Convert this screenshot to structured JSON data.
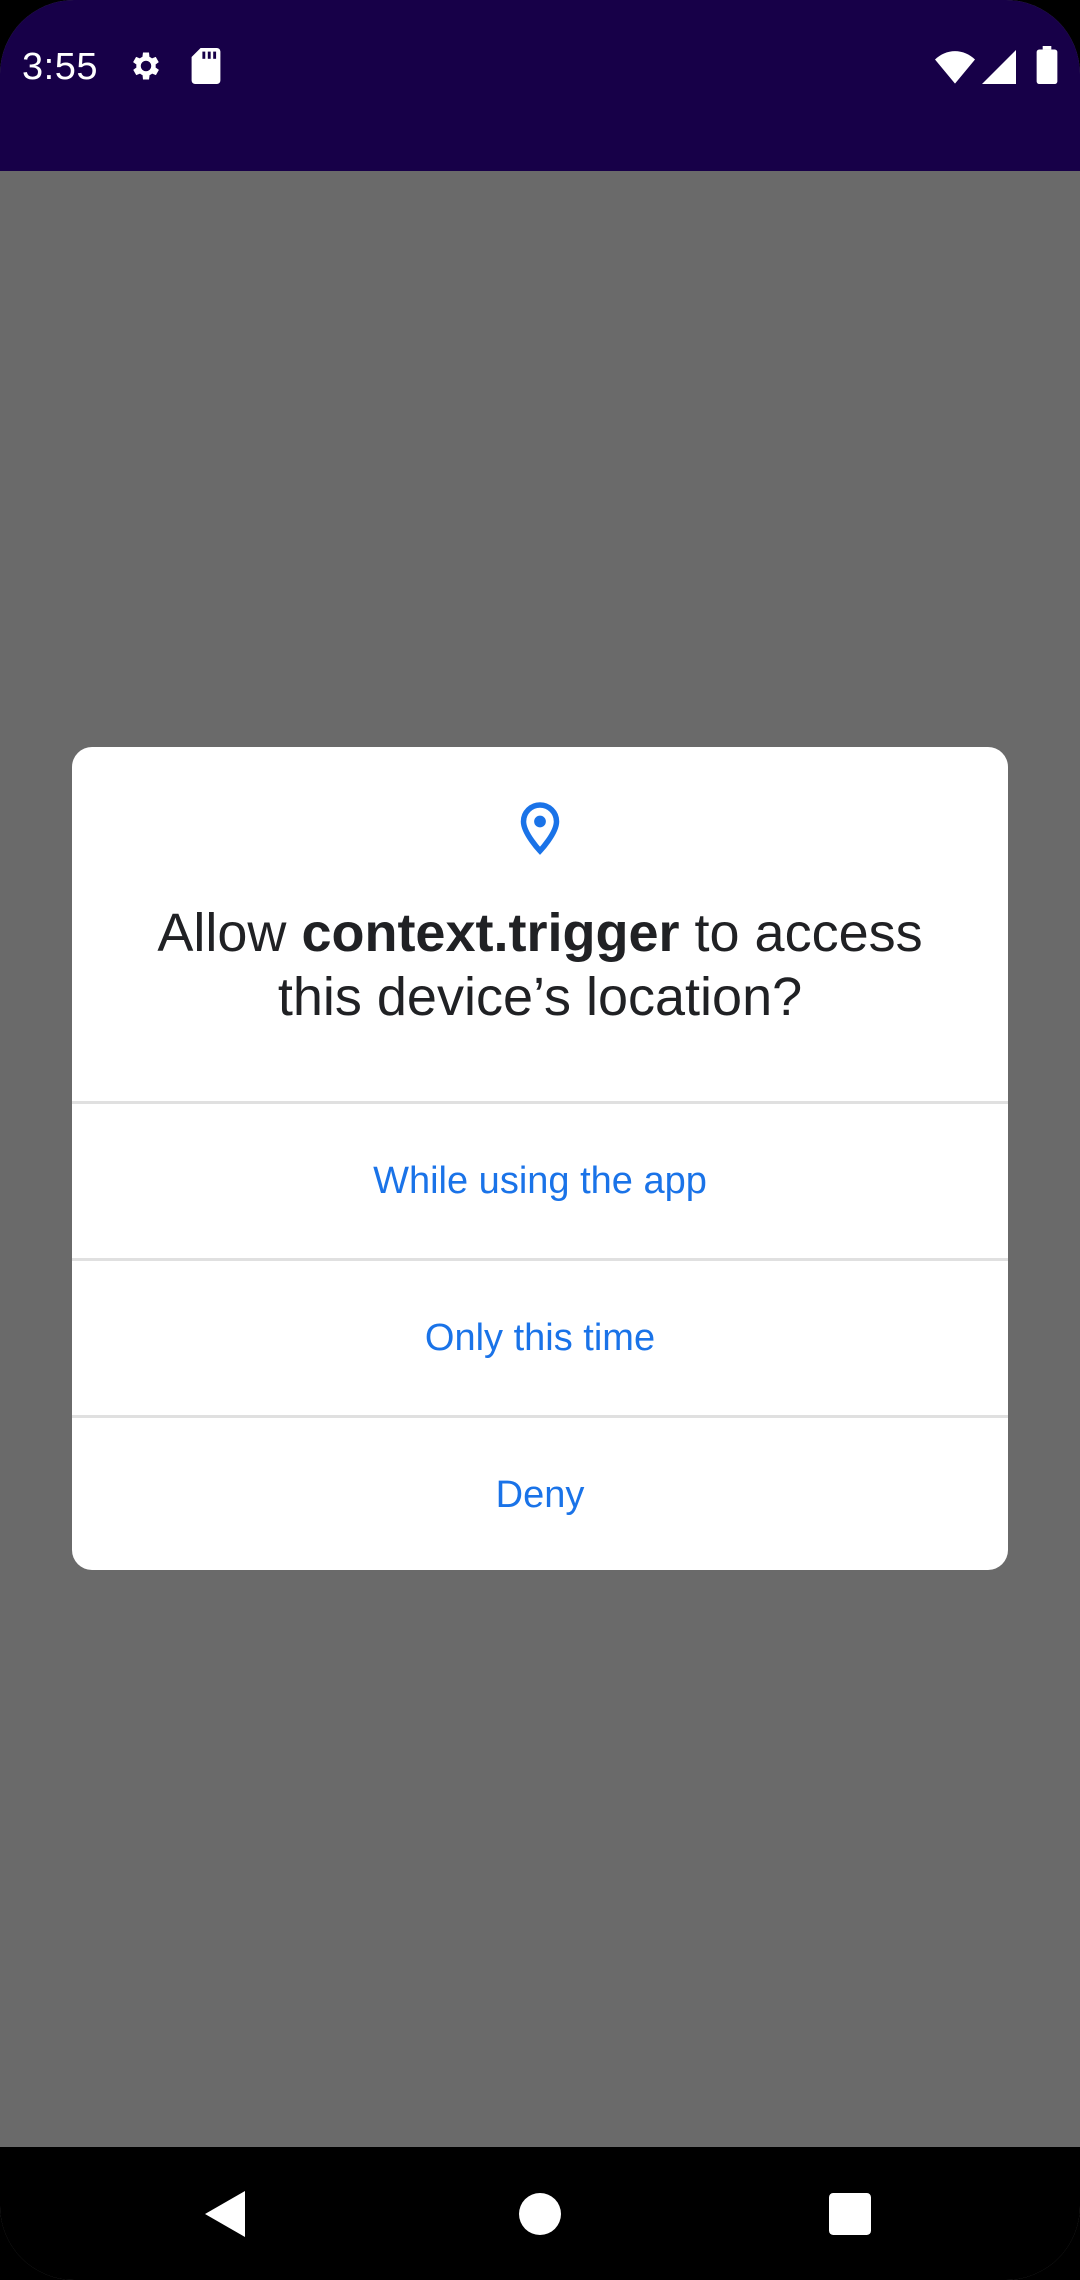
{
  "status_bar": {
    "time": "3:55",
    "background": "#170048",
    "icons": [
      "gear-icon",
      "sd-card-icon",
      "wifi-icon",
      "signal-icon",
      "battery-icon"
    ]
  },
  "dialog": {
    "icon": "location-pin-icon",
    "title_prefix": "Allow ",
    "app_name": "context.trigger",
    "title_suffix": " to access this device’s location?",
    "options": [
      {
        "label": "While using the app"
      },
      {
        "label": "Only this time"
      },
      {
        "label": "Deny"
      }
    ],
    "accent_color": "#1a73e8"
  },
  "nav_bar": {
    "buttons": [
      "back-icon",
      "home-icon",
      "recents-icon"
    ]
  }
}
